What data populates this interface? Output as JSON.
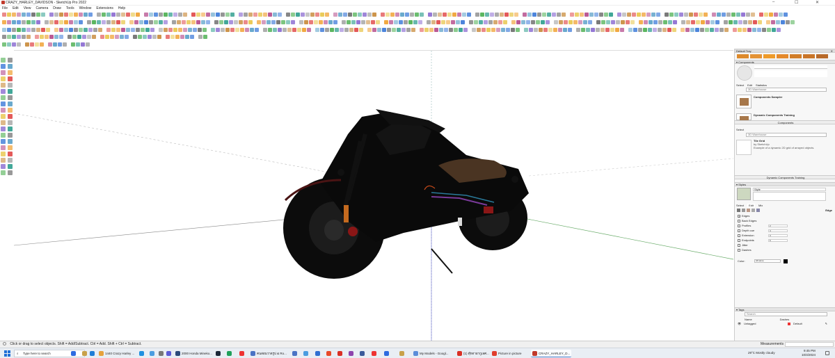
{
  "window": {
    "title": "CRAZY_HARLEY_DAVIDSON - SketchUp Pro 2022",
    "minimize": "–",
    "maximize": "☐",
    "close": "✕"
  },
  "menu": [
    "File",
    "Edit",
    "View",
    "Camera",
    "Draw",
    "Tools",
    "Window",
    "Extensions",
    "Help"
  ],
  "colors": {
    "accent": "#3b79d8",
    "tray_swatches": [
      "#dd8a2c",
      "#e49336",
      "#ee9b2a",
      "#e5892a",
      "#d17d28",
      "#c97528",
      "#b86a2a"
    ]
  },
  "tray": {
    "title": "Default Tray",
    "components": {
      "header": "Components",
      "tabs": [
        "Select",
        "Edit",
        "Statistics"
      ],
      "search_placeholder": "3D Warehouse",
      "items": [
        {
          "name": "Components Sampler",
          "desc": ""
        },
        {
          "name": "Dynamic Components Training",
          "desc": ""
        }
      ],
      "footer": "Components"
    },
    "select": {
      "header": "Select",
      "search_placeholder": "3D Warehouse",
      "item_name": "Tile Grid",
      "item_by": "by SketchUp",
      "item_desc": "Example of a dynamic 2D grid of arrayed objects.",
      "footer": "Dynamic Components Training"
    },
    "styles": {
      "header": "Styles",
      "name_value": "Style",
      "tabs": [
        "Select",
        "Edit",
        "Mix"
      ],
      "edge_label": "Edge",
      "checks": [
        {
          "label": "Edges",
          "checked": true,
          "value": ""
        },
        {
          "label": "Back Edges",
          "checked": false,
          "value": ""
        },
        {
          "label": "Profiles",
          "checked": false,
          "value": "2"
        },
        {
          "label": "Depth cue",
          "checked": false,
          "value": "4"
        },
        {
          "label": "Extension",
          "checked": false,
          "value": "3"
        },
        {
          "label": "Endpoints",
          "checked": false,
          "value": "6"
        },
        {
          "label": "Jitter",
          "checked": false,
          "value": ""
        },
        {
          "label": "Dashes",
          "checked": false,
          "value": ""
        }
      ],
      "color_label": "Color:",
      "color_value": "All same"
    },
    "tags": {
      "header": "Tags",
      "search_placeholder": "Search",
      "col_name": "Name",
      "col_dashes": "Dashes",
      "rows": [
        {
          "name": "Untagged",
          "dashes": "Default"
        }
      ]
    }
  },
  "status": {
    "hint": "Click or drag to select objects. Shift = Add/Subtract. Ctrl = Add. Shift + Ctrl = Subtract.",
    "measurements_label": "Measurements"
  },
  "taskbar": {
    "search_placeholder": "Type here to search",
    "apps": [
      {
        "label": "1440 Crazy Harley ...",
        "color": "#e6a23c",
        "open": false
      },
      {
        "label": "2000 Honda Mineko...",
        "color": "#2b4a7a",
        "open": false
      },
      {
        "label": "คนสอนวาดรูป & Ro...",
        "color": "#4a73c4",
        "open": false
      },
      {
        "label": "My Models - Googl...",
        "color": "#5b8dd9",
        "open": false
      },
      {
        "label": "(1) ตุ๊กตาอากูเลศ...",
        "color": "#d93025",
        "open": false
      },
      {
        "label": "Picture in picture",
        "color": "#e03e2d",
        "open": false
      },
      {
        "label": "CRAZY_HARLEY_D...",
        "color": "#c0392b",
        "open": true
      }
    ],
    "weather": "29°C  Mostly cloudy",
    "time": "9:45 PM",
    "date": "10/4/2024"
  }
}
